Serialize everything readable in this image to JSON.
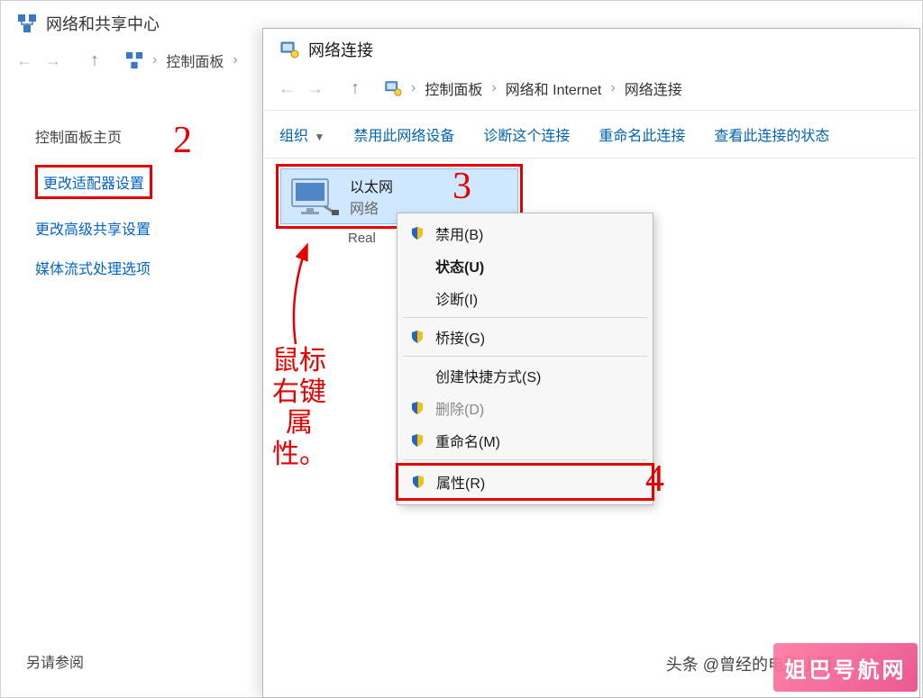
{
  "bg_window": {
    "title": "网络和共享中心",
    "breadcrumb": {
      "item1": "控制面板"
    },
    "sidebar": {
      "home": "控制面板主页",
      "adapter": "更改适配器设置",
      "advanced": "更改高级共享设置",
      "media": "媒体流式处理选项"
    },
    "see_also": "另请参阅"
  },
  "fg_window": {
    "title": "网络连接",
    "breadcrumb": {
      "item1": "控制面板",
      "item2": "网络和 Internet",
      "item3": "网络连接"
    },
    "toolbar": {
      "organize": "组织",
      "disable_device": "禁用此网络设备",
      "diagnose": "诊断这个连接",
      "rename": "重命名此连接",
      "view_status": "查看此连接的状态"
    },
    "item": {
      "name": "以太网",
      "status": "网络",
      "device_prefix": "Real"
    },
    "context_menu": {
      "disable": "禁用(B)",
      "status": "状态(U)",
      "diagnose": "诊断(I)",
      "bridge": "桥接(G)",
      "shortcut": "创建快捷方式(S)",
      "delete": "删除(D)",
      "rename": "重命名(M)",
      "properties": "属性(R)"
    }
  },
  "annotations": {
    "num2": "2",
    "num3": "3",
    "num4": "4",
    "note": "鼠标\n右键\n属性。"
  },
  "credit": "头条 @曾经的电脑小哥",
  "watermark": "姐巴号航网"
}
